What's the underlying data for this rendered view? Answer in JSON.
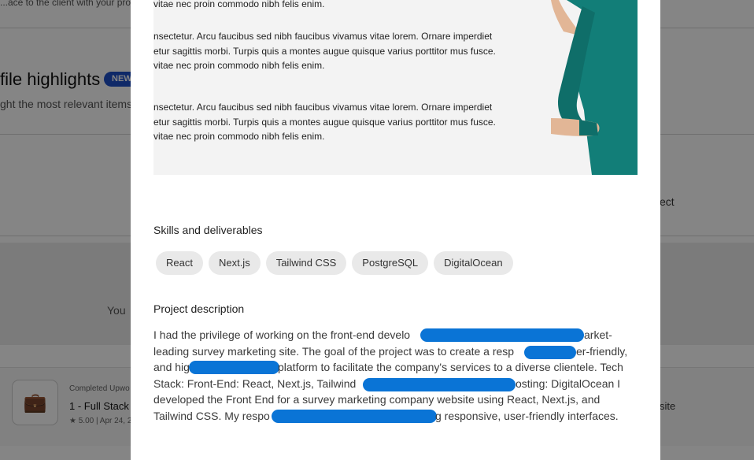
{
  "background": {
    "top_text": "...ace to the client with your pro...",
    "highlights_title": "file highlights",
    "new_badge": "NEW",
    "highlights_sub": "ght the most relevant items",
    "right_fragment": "ect",
    "grey_text": "You",
    "completed_label": "Completed Upwo",
    "job_title": "1 - Full Stack D",
    "rating": "★ 5.00 | Apr 24, 2",
    "right_site": "site"
  },
  "modal": {
    "hero_text": [
      "vitae nec proin commodo nibh felis enim.",
      "nsectetur. Arcu faucibus sed nibh faucibus vivamus vitae lorem. Ornare imperdiet",
      "etur sagittis morbi. Turpis quis a montes augue quisque varius porttitor mus fusce.",
      "vitae nec proin commodo nibh felis enim.",
      "nsectetur. Arcu faucibus sed nibh faucibus vivamus vitae lorem. Ornare imperdiet",
      "etur sagittis morbi. Turpis quis a montes augue quisque varius porttitor mus fusce.",
      "vitae nec proin commodo nibh felis enim."
    ],
    "skills_title": "Skills and deliverables",
    "skills": [
      "React",
      "Next.js",
      "Tailwind CSS",
      "PostgreSQL",
      "DigitalOcean"
    ],
    "description_title": "Project description",
    "description_lines": [
      "I had the privilege of working on the front-end develo",
      "arket-",
      "leading survey marketing site. The goal of the project was to create a resp",
      "er-friendly,",
      "and hig",
      "platform to facilitate the company's services to a diverse clientele. Tech",
      "Stack: Front-End: React, Next.js, Tailwind",
      "osting: DigitalOcean I",
      "developed the Front End for a survey marketing company website using React, Next.js, and",
      "Tailwind CSS. My respo",
      "g responsive, user-friendly interfaces."
    ]
  },
  "colors": {
    "redaction": "#0a74d6",
    "badge": "#1e4fc8",
    "sweater": "#127e78"
  }
}
